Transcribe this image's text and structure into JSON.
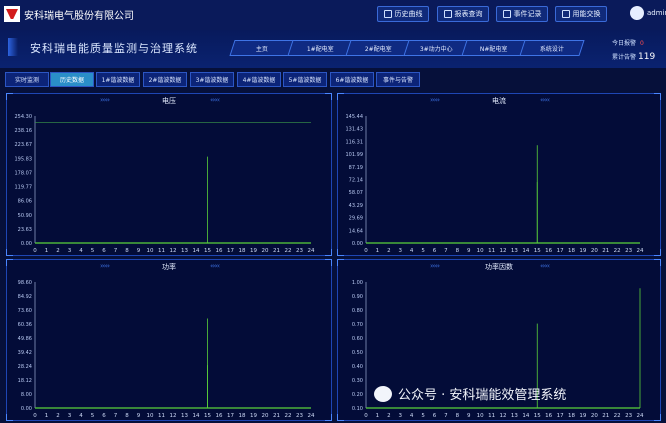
{
  "topbar": {
    "company": "安科瑞电气股份有限公司",
    "buttons": [
      {
        "label": "历史曲线",
        "icon": "chart-icon"
      },
      {
        "label": "报表查询",
        "icon": "search-icon"
      },
      {
        "label": "事件记录",
        "icon": "list-icon"
      },
      {
        "label": "用能交换",
        "icon": "swap-icon"
      }
    ],
    "user": "admin"
  },
  "header": {
    "title": "安科瑞电能质量监测与治理系统",
    "nav": [
      "主页",
      "1#配电室",
      "2#配电室",
      "3#动力中心",
      "N#配电室",
      "系统设计"
    ],
    "alarm_label": "今日报警",
    "alarm_value": "0",
    "stat_label": "累计告警",
    "stat_value": "119"
  },
  "subtabs": {
    "items": [
      "实时监测",
      "历史数据",
      "1#谐波数据",
      "2#谐波数据",
      "3#谐波数据",
      "4#谐波数据",
      "5#谐波数据",
      "6#谐波数据",
      "事件与告警"
    ],
    "active": 1
  },
  "charts": [
    {
      "title": "电压",
      "yticks": [
        "254.30",
        "238.16",
        "223.67",
        "195.83",
        "178.07",
        "119.77",
        "86.06",
        "50.90",
        "23.63",
        "0.00"
      ],
      "series": [
        {
          "x": 15,
          "y": 0.68
        }
      ],
      "hline": 0.95
    },
    {
      "title": "电流",
      "yticks": [
        "145.44",
        "131.43",
        "116.31",
        "101.99",
        "87.19",
        "72.14",
        "58.07",
        "43.29",
        "29.69",
        "14.64",
        "0.00"
      ],
      "series": [
        {
          "x": 15,
          "y": 0.77
        },
        {
          "x": 15,
          "y": 0.48
        }
      ],
      "hline": null
    },
    {
      "title": "功率",
      "yticks": [
        "98.60",
        "84.92",
        "73.60",
        "60.36",
        "49.86",
        "39.42",
        "28.24",
        "18.12",
        "8.00",
        "0.00"
      ],
      "series": [
        {
          "x": 15,
          "y": 0.34
        },
        {
          "x": 15,
          "y": 0.71
        }
      ],
      "hline": null
    },
    {
      "title": "功率因数",
      "yticks": [
        "1.00",
        "0.90",
        "0.80",
        "0.70",
        "0.60",
        "0.50",
        "0.40",
        "0.30",
        "0.20",
        "0.10"
      ],
      "series": [
        {
          "x": 15,
          "y": 0.67
        },
        {
          "x": 24,
          "y": 0.95
        }
      ],
      "hline": null
    }
  ],
  "xticks": [
    "0",
    "1",
    "2",
    "3",
    "4",
    "5",
    "6",
    "7",
    "8",
    "9",
    "10",
    "11",
    "12",
    "13",
    "14",
    "15",
    "16",
    "17",
    "18",
    "19",
    "20",
    "21",
    "22",
    "23",
    "24"
  ],
  "watermark": "公众号 · 安科瑞能效管理系统"
}
